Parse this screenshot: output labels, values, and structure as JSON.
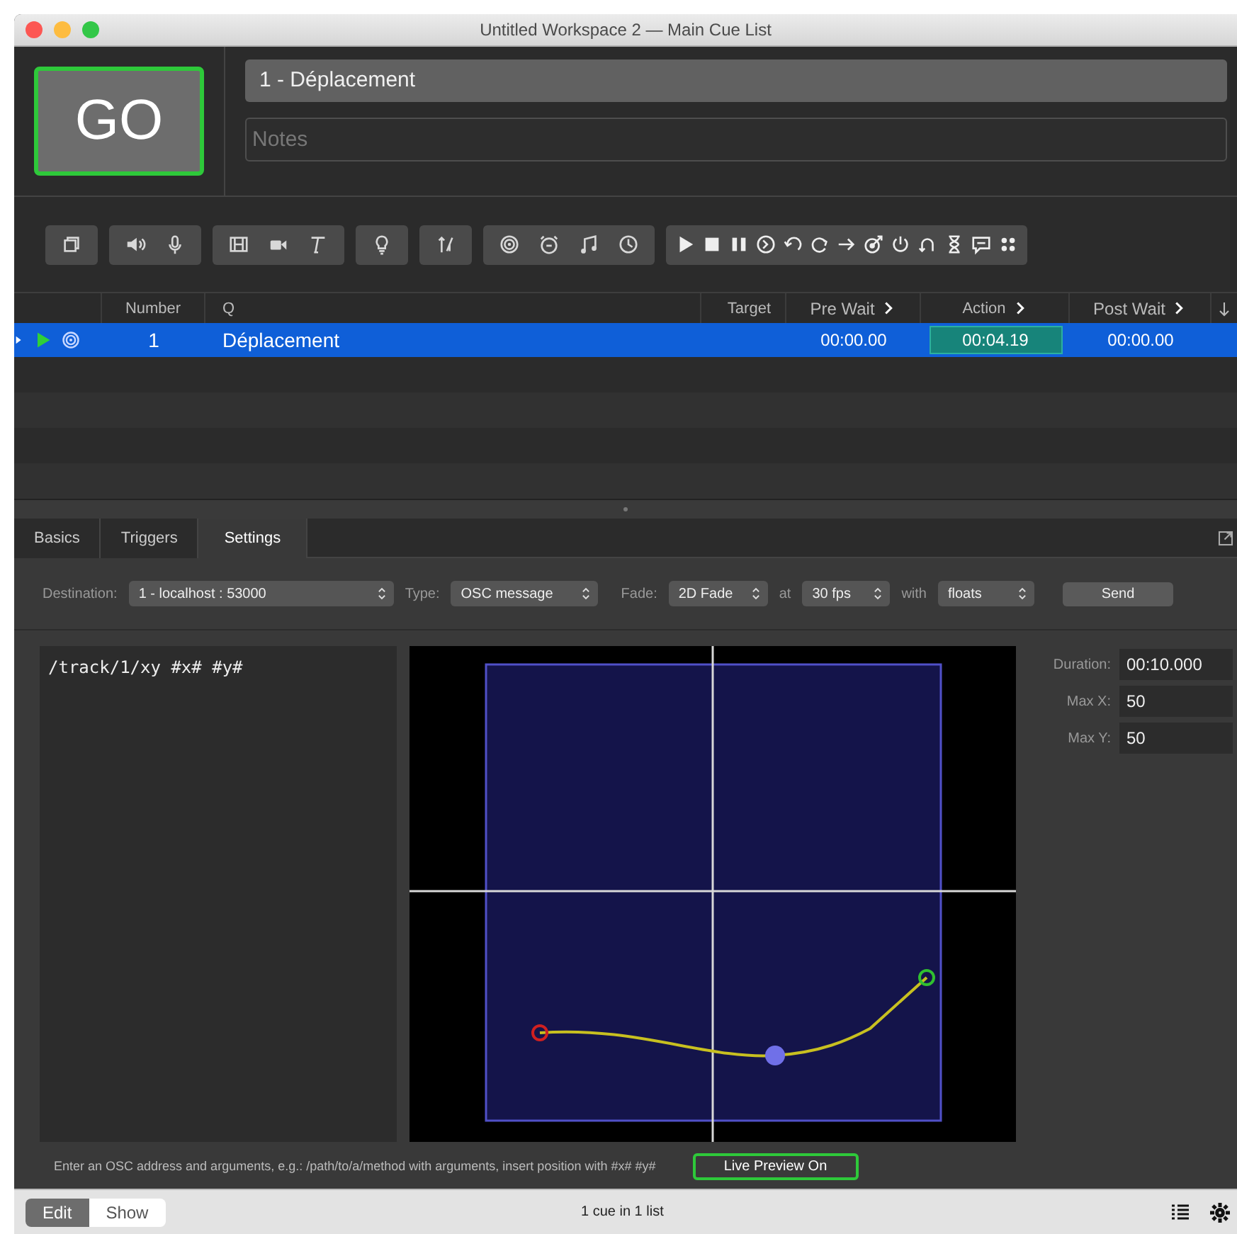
{
  "window": {
    "title": "Untitled Workspace 2 — Main Cue List"
  },
  "go_button": {
    "label": "GO"
  },
  "cue_name": {
    "value": "1 - Déplacement"
  },
  "notes": {
    "placeholder": "Notes"
  },
  "cue_table": {
    "columns": [
      {
        "label": "Number",
        "disclosure": false
      },
      {
        "label": "Q",
        "disclosure": false
      },
      {
        "label": "Target",
        "disclosure": false
      },
      {
        "label": "Pre Wait",
        "disclosure": true
      },
      {
        "label": "Action",
        "disclosure": true
      },
      {
        "label": "Post Wait",
        "disclosure": true
      }
    ],
    "rows": [
      {
        "selected": true,
        "playing": true,
        "number": "1",
        "q": "Déplacement",
        "pre_wait": "00:00.00",
        "action": "00:04.19",
        "post_wait": "00:00.00"
      }
    ]
  },
  "inspector": {
    "tabs": [
      {
        "label": "Basics",
        "selected": false
      },
      {
        "label": "Triggers",
        "selected": false
      },
      {
        "label": "Settings",
        "selected": true
      }
    ],
    "settings": [
      {
        "label": "Destination:",
        "value": "1 - localhost : 53000"
      },
      {
        "label": "Type:",
        "value": "OSC message"
      },
      {
        "label": "Fade:",
        "value": "2D Fade"
      },
      {
        "label": "at",
        "value": "30 fps"
      },
      {
        "label": "with",
        "value": "floats"
      }
    ],
    "send_button": "Send",
    "message": {
      "value": "/track/1/xy #x# #y#"
    },
    "fields": [
      {
        "label": "Duration:",
        "value": "00:10.000"
      },
      {
        "label": "Max X:",
        "value": "50"
      },
      {
        "label": "Max Y:",
        "value": "50"
      }
    ],
    "hint": "Enter an OSC address and arguments, e.g.: /path/to/a/method with arguments, insert position with #x# #y#",
    "live_preview": {
      "label": "Live Preview On",
      "on": true
    }
  },
  "status_bar": {
    "modes": [
      {
        "label": "Edit",
        "selected": true
      },
      {
        "label": "Show",
        "selected": false
      }
    ],
    "text": "1 cue in 1 list"
  }
}
